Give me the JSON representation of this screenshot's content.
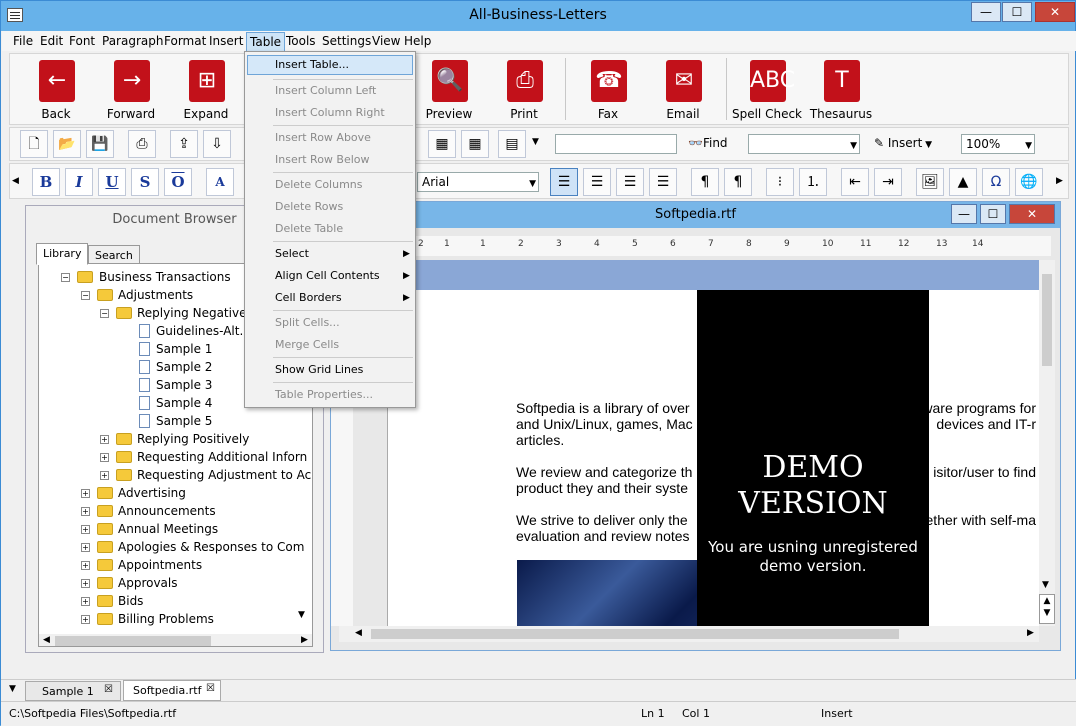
{
  "window": {
    "title": "All-Business-Letters",
    "min": "—",
    "max": "☐",
    "close": "✕"
  },
  "menu": [
    "File",
    "Edit",
    "Font",
    "Paragraph",
    "Format",
    "Insert",
    "Table",
    "Tools",
    "Settings",
    "View",
    "Help"
  ],
  "toolbar": {
    "back": "Back",
    "forward": "Forward",
    "expand": "Expand",
    "preview": "Preview",
    "print": "Print",
    "fax": "Fax",
    "email": "Email",
    "spellcheck": "Spell Check",
    "thesaurus": "Thesaurus"
  },
  "toolbar2": {
    "find": "Find",
    "insert": "Insert",
    "zoom": "100%",
    "search_value": ""
  },
  "toolbar3": {
    "font": "Arial"
  },
  "table_menu": {
    "items": [
      {
        "label": "Insert Table...",
        "enabled": true
      },
      {
        "label": "Insert Column Left",
        "enabled": false
      },
      {
        "label": "Insert Column Right",
        "enabled": false
      },
      {
        "label": "Insert Row Above",
        "enabled": false
      },
      {
        "label": "Insert Row Below",
        "enabled": false
      },
      {
        "label": "Delete Columns",
        "enabled": false
      },
      {
        "label": "Delete Rows",
        "enabled": false
      },
      {
        "label": "Delete Table",
        "enabled": false
      },
      {
        "label": "Select",
        "enabled": true
      },
      {
        "label": "Align Cell Contents",
        "enabled": true
      },
      {
        "label": "Cell Borders",
        "enabled": true
      },
      {
        "label": "Split Cells...",
        "enabled": false
      },
      {
        "label": "Merge Cells",
        "enabled": false
      },
      {
        "label": "Show Grid Lines",
        "enabled": true
      },
      {
        "label": "Table Properties...",
        "enabled": false
      }
    ]
  },
  "doc_browser": {
    "title": "Document Browser",
    "tabs": [
      "Library",
      "Search"
    ],
    "tree": [
      "Business Transactions",
      "Adjustments",
      "Replying Negatively",
      "Guidelines-Alt. F",
      "Sample 1",
      "Sample 2",
      "Sample 3",
      "Sample 4",
      "Sample 5",
      "Replying Positively",
      "Requesting Additional Inforn",
      "Requesting Adjustment to Ac",
      "Advertising",
      "Announcements",
      "Annual Meetings",
      "Apologies & Responses to Com",
      "Appointments",
      "Approvals",
      "Bids",
      "Billing Problems"
    ]
  },
  "document": {
    "title": "Softpedia.rtf",
    "ruler": [
      "2",
      "1",
      "1",
      "2",
      "3",
      "4",
      "5",
      "6",
      "7",
      "8",
      "9",
      "10",
      "11",
      "12",
      "13",
      "14"
    ],
    "paragraphs": [
      [
        "Softpedia is a library of over",
        "ware programs for"
      ],
      [
        "and Unix/Linux, games, Mac",
        "devices and IT-r"
      ],
      [
        "articles.",
        ""
      ],
      [
        "We review and categorize th",
        "isitor/user to find"
      ],
      [
        "product they and their syste",
        ""
      ],
      [
        "We strive to deliver only the",
        "ether with self-ma"
      ],
      [
        "evaluation and review notes",
        ""
      ]
    ],
    "demo_title1": "DEMO",
    "demo_title2": "VERSION",
    "demo_line1": "You are usning unregistered",
    "demo_line2": "demo version."
  },
  "bottom_tabs": [
    "Sample 1",
    "Softpedia.rtf"
  ],
  "status": {
    "path": "C:\\Softpedia Files\\Softpedia.rtf",
    "ln": "Ln 1",
    "col": "Col 1",
    "mode": "Insert"
  }
}
